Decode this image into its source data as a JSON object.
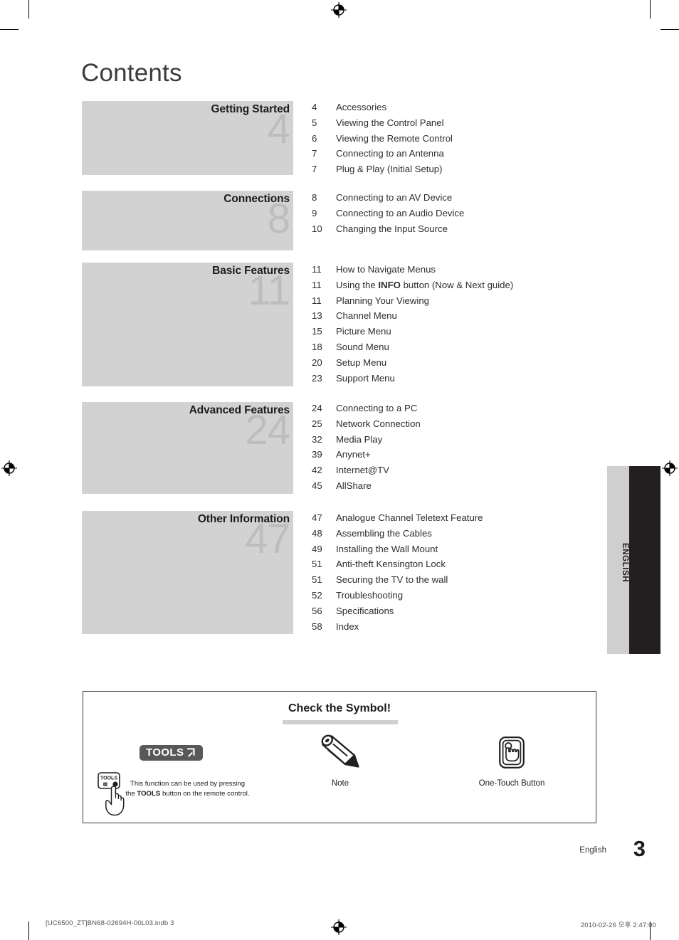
{
  "page": {
    "title": "Contents",
    "footer_language": "English",
    "footer_page_number": "3",
    "print_footer_left": "[UC6500_ZT]BN68-02694H-00L03.indb   3",
    "print_footer_right": "2010-02-26   오후 2:47:00",
    "side_tab_label": "ENGLISH"
  },
  "colors": {
    "block_bg": "#d2d2d2",
    "block_number": "#bdbdbd",
    "tab_light": "#cfcfcf",
    "tab_dark": "#231f20",
    "badge_bg": "#58585a",
    "rule": "#d0d0d0"
  },
  "toc": {
    "sections": [
      {
        "heading": "Getting Started",
        "number": "4",
        "items": [
          {
            "page": "4",
            "label": "Accessories"
          },
          {
            "page": "5",
            "label": "Viewing the Control Panel"
          },
          {
            "page": "6",
            "label": "Viewing the Remote Control"
          },
          {
            "page": "7",
            "label": "Connecting to an Antenna"
          },
          {
            "page": "7",
            "label": "Plug & Play (Initial Setup)"
          }
        ]
      },
      {
        "heading": "Connections",
        "number": "8",
        "items": [
          {
            "page": "8",
            "label": "Connecting to an AV Device"
          },
          {
            "page": "9",
            "label": "Connecting to an Audio Device"
          },
          {
            "page": "10",
            "label": "Changing the Input Source"
          }
        ]
      },
      {
        "heading": "Basic Features",
        "number": "11",
        "items": [
          {
            "page": "11",
            "label": "How to Navigate Menus"
          },
          {
            "page": "11",
            "label": "Using the INFO button (Now & Next guide)",
            "bold_word": "INFO"
          },
          {
            "page": "11",
            "label": "Planning Your Viewing"
          },
          {
            "page": "13",
            "label": "Channel Menu"
          },
          {
            "page": "15",
            "label": "Picture Menu"
          },
          {
            "page": "18",
            "label": "Sound Menu"
          },
          {
            "page": "20",
            "label": "Setup Menu"
          },
          {
            "page": "23",
            "label": "Support Menu"
          }
        ]
      },
      {
        "heading": "Advanced Features",
        "number": "24",
        "items": [
          {
            "page": "24",
            "label": "Connecting to a PC"
          },
          {
            "page": "25",
            "label": "Network Connection"
          },
          {
            "page": "32",
            "label": "Media Play"
          },
          {
            "page": "39",
            "label": "Anynet+"
          },
          {
            "page": "42",
            "label": "Internet@TV"
          },
          {
            "page": "45",
            "label": "AllShare"
          }
        ]
      },
      {
        "heading": "Other Information",
        "number": "47",
        "items": [
          {
            "page": "47",
            "label": "Analogue Channel Teletext Feature"
          },
          {
            "page": "48",
            "label": "Assembling the Cables"
          },
          {
            "page": "49",
            "label": "Installing the Wall Mount"
          },
          {
            "page": "51",
            "label": "Anti-theft Kensington Lock"
          },
          {
            "page": "51",
            "label": "Securing the TV to the wall"
          },
          {
            "page": "52",
            "label": "Troubleshooting"
          },
          {
            "page": "56",
            "label": "Specifications"
          },
          {
            "page": "58",
            "label": "Index"
          }
        ]
      }
    ]
  },
  "symbol_box": {
    "title": "Check the Symbol!",
    "columns": [
      {
        "icon": "tools-badge-icon",
        "badge_text": "TOOLS",
        "caption": "This function can be used by pressing the TOOLS button on the remote control.",
        "caption_bold": "TOOLS"
      },
      {
        "icon": "pencil-icon",
        "caption": "Note"
      },
      {
        "icon": "one-touch-button-icon",
        "caption": "One-Touch Button"
      }
    ]
  }
}
